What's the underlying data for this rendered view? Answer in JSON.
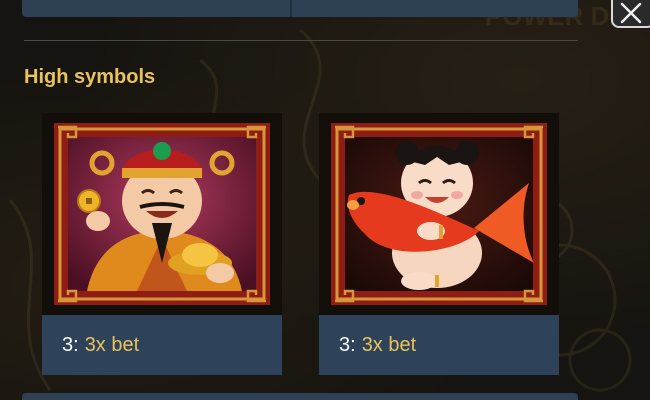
{
  "section": {
    "title": "High symbols"
  },
  "close_button": {
    "icon": "close-icon"
  },
  "background": {
    "watermark_text": "POWER DRAGONS"
  },
  "symbols": [
    {
      "name_icon": "god-of-wealth-icon",
      "count": "3:",
      "payout": "3x bet"
    },
    {
      "name_icon": "child-with-koi-fish-icon",
      "count": "3:",
      "payout": "3x bet"
    }
  ],
  "colors": {
    "accent_gold": "#e8c25c",
    "panel_blue": "#2e4359",
    "frame_red": "#8e1d14",
    "frame_gold": "#d8963a"
  }
}
